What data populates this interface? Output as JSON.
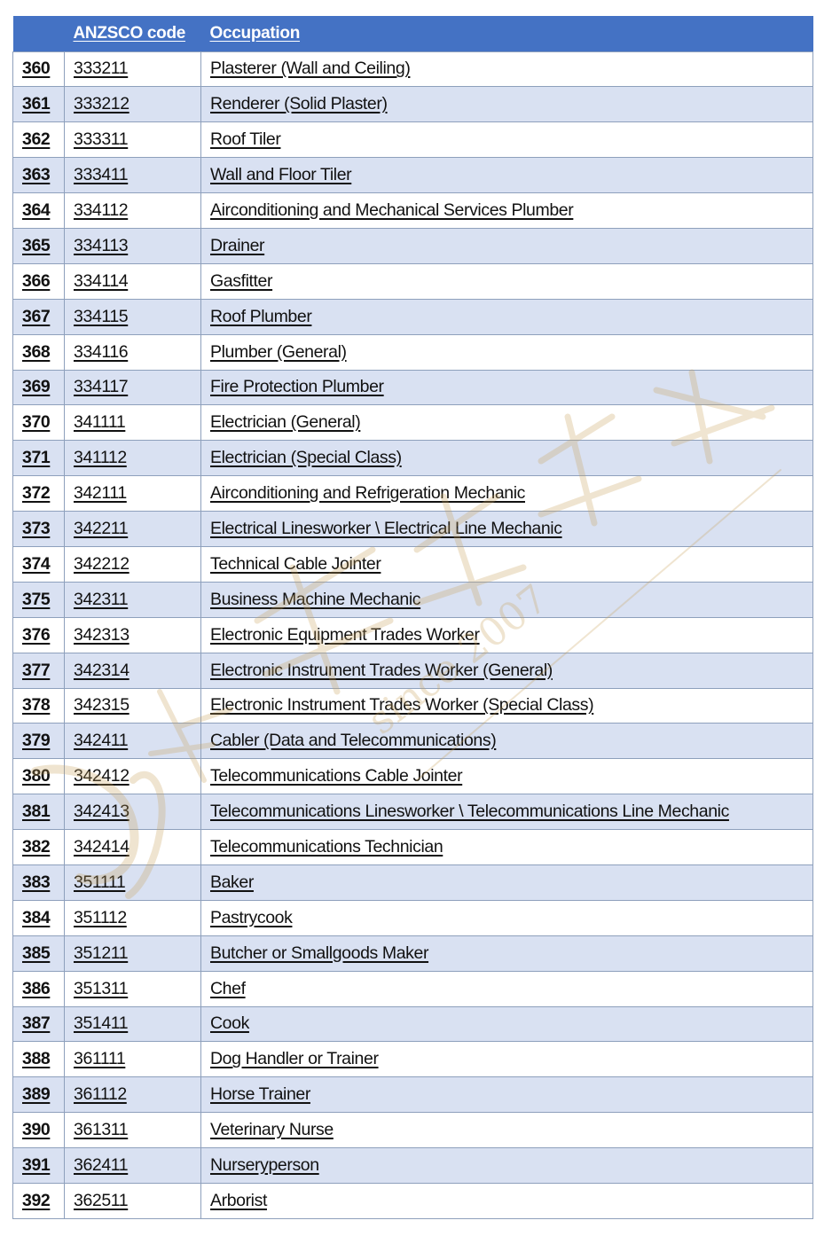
{
  "table": {
    "headers": {
      "number": "",
      "code": "ANZSCO code",
      "occupation": "Occupation"
    },
    "rows": [
      {
        "num": "360",
        "code": "333211",
        "occupation": "Plasterer (Wall and Ceiling)"
      },
      {
        "num": "361",
        "code": "333212",
        "occupation": "Renderer (Solid Plaster)"
      },
      {
        "num": "362",
        "code": "333311",
        "occupation": "Roof Tiler"
      },
      {
        "num": "363",
        "code": "333411",
        "occupation": "Wall and Floor Tiler"
      },
      {
        "num": "364",
        "code": "334112",
        "occupation": "Airconditioning and Mechanical Services Plumber"
      },
      {
        "num": "365",
        "code": "334113",
        "occupation": "Drainer"
      },
      {
        "num": "366",
        "code": "334114",
        "occupation": "Gasfitter"
      },
      {
        "num": "367",
        "code": "334115",
        "occupation": "Roof Plumber"
      },
      {
        "num": "368",
        "code": "334116",
        "occupation": "Plumber (General)"
      },
      {
        "num": "369",
        "code": "334117",
        "occupation": "Fire Protection Plumber"
      },
      {
        "num": "370",
        "code": "341111",
        "occupation": "Electrician (General)"
      },
      {
        "num": "371",
        "code": "341112",
        "occupation": "Electrician (Special Class)"
      },
      {
        "num": "372",
        "code": "342111",
        "occupation": "Airconditioning and Refrigeration Mechanic"
      },
      {
        "num": "373",
        "code": "342211",
        "occupation": "Electrical Linesworker \\ Electrical Line Mechanic"
      },
      {
        "num": "374",
        "code": "342212",
        "occupation": "Technical Cable Jointer"
      },
      {
        "num": "375",
        "code": "342311",
        "occupation": "Business Machine Mechanic"
      },
      {
        "num": "376",
        "code": "342313",
        "occupation": "Electronic Equipment Trades Worker"
      },
      {
        "num": "377",
        "code": "342314",
        "occupation": "Electronic Instrument Trades Worker (General)"
      },
      {
        "num": "378",
        "code": "342315",
        "occupation": "Electronic Instrument Trades Worker (Special Class)"
      },
      {
        "num": "379",
        "code": "342411",
        "occupation": "Cabler (Data and Telecommunications)"
      },
      {
        "num": "380",
        "code": "342412",
        "occupation": "Telecommunications Cable Jointer"
      },
      {
        "num": "381",
        "code": "342413",
        "occupation": "Telecommunications Linesworker \\ Telecommunications Line Mechanic"
      },
      {
        "num": "382",
        "code": "342414",
        "occupation": "Telecommunications Technician"
      },
      {
        "num": "383",
        "code": "351111",
        "occupation": "Baker"
      },
      {
        "num": "384",
        "code": "351112",
        "occupation": "Pastrycook"
      },
      {
        "num": "385",
        "code": "351211",
        "occupation": "Butcher or Smallgoods Maker"
      },
      {
        "num": "386",
        "code": "351311",
        "occupation": "Chef"
      },
      {
        "num": "387",
        "code": "351411",
        "occupation": "Cook"
      },
      {
        "num": "388",
        "code": "361111",
        "occupation": "Dog Handler or Trainer"
      },
      {
        "num": "389",
        "code": "361112",
        "occupation": "Horse Trainer"
      },
      {
        "num": "390",
        "code": "361311",
        "occupation": "Veterinary Nurse"
      },
      {
        "num": "391",
        "code": "362411",
        "occupation": "Nurseryperson"
      },
      {
        "num": "392",
        "code": "362511",
        "occupation": "Arborist"
      }
    ]
  },
  "watermark": {
    "text": "since 2007",
    "color": "#C9A25A"
  },
  "colors": {
    "header_bg": "#4472C4",
    "header_text": "#FFFFFF",
    "row_alt_bg": "#D9E1F2",
    "row_bg": "#FFFFFF",
    "border": "#8EA0BC"
  }
}
